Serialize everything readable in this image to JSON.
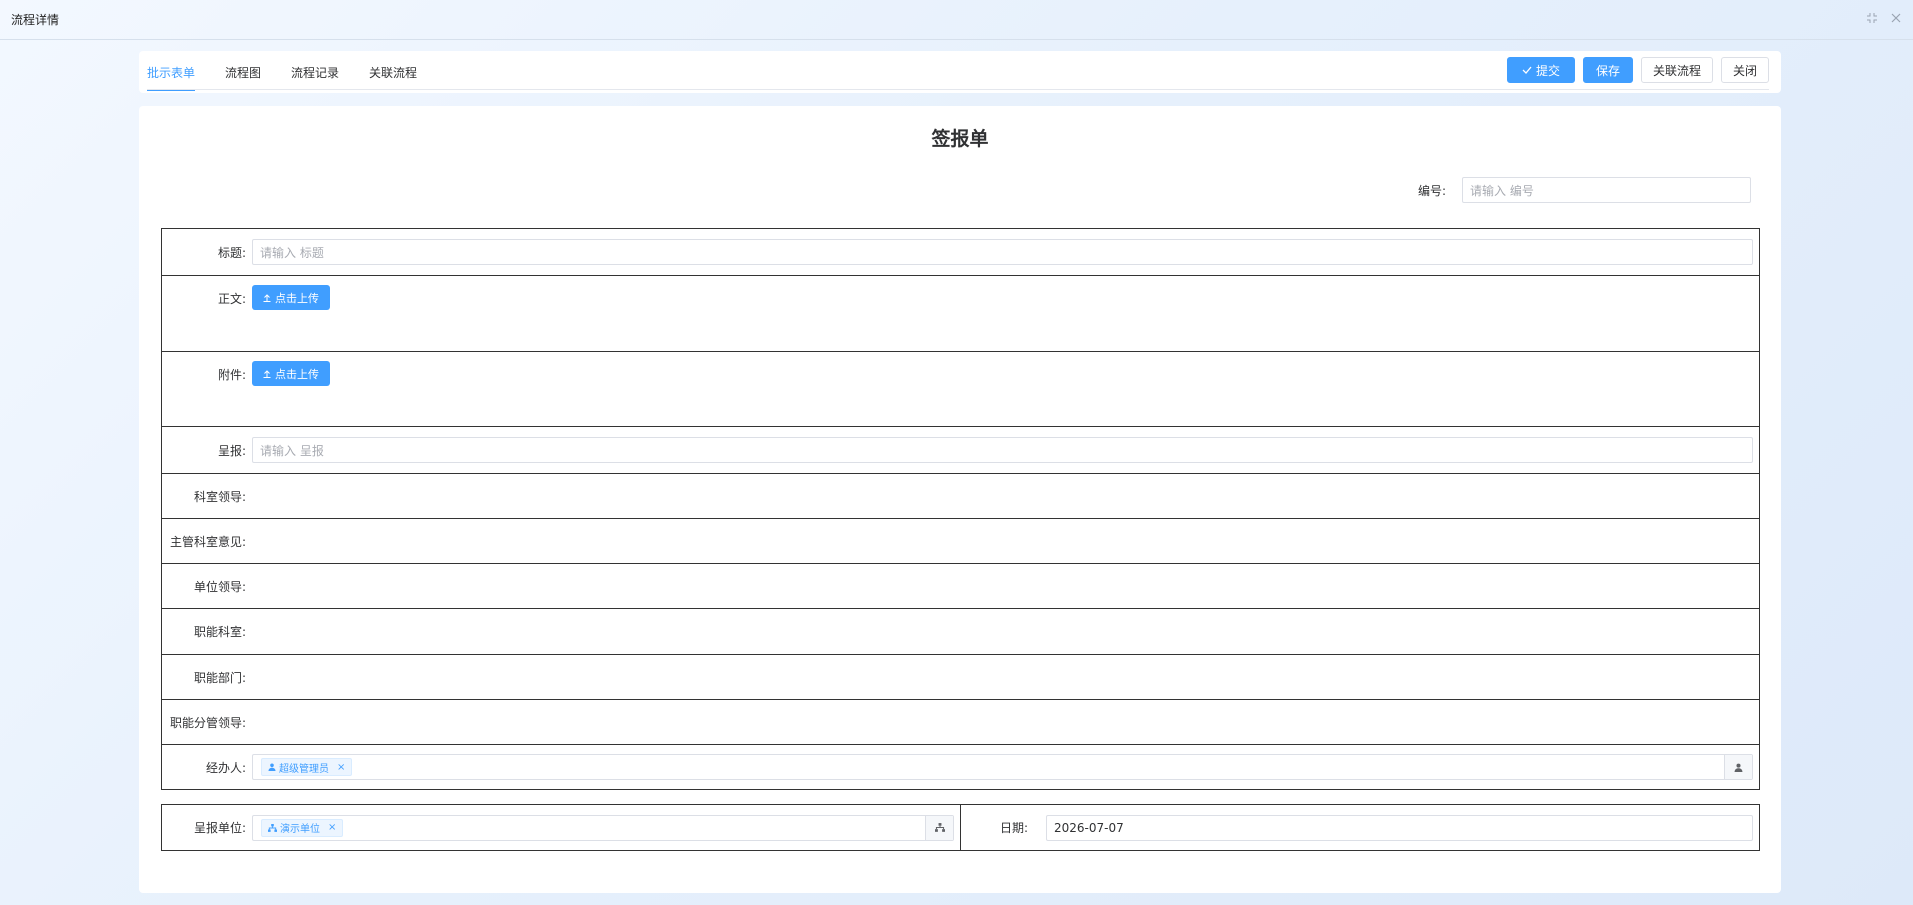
{
  "window": {
    "title": "流程详情"
  },
  "tabs": [
    {
      "label": "批示表单",
      "active": true
    },
    {
      "label": "流程图",
      "active": false
    },
    {
      "label": "流程记录",
      "active": false
    },
    {
      "label": "关联流程",
      "active": false
    }
  ],
  "actions": {
    "submit": "提交",
    "save": "保存",
    "related": "关联流程",
    "close": "关闭"
  },
  "form": {
    "title": "签报单",
    "number": {
      "label": "编号:",
      "placeholder": "请输入 编号"
    },
    "subject": {
      "label": "标题:",
      "placeholder": "请输入 标题"
    },
    "body": {
      "label": "正文:",
      "button": "点击上传"
    },
    "attachment": {
      "label": "附件:",
      "button": "点击上传"
    },
    "report": {
      "label": "呈报:",
      "placeholder": "请输入 呈报"
    },
    "section_leader": {
      "label": "科室领导:"
    },
    "dept_opinion": {
      "label": "主管科室意见:"
    },
    "unit_leader": {
      "label": "单位领导:"
    },
    "function_office": {
      "label": "职能科室:"
    },
    "function_dept": {
      "label": "职能部门:"
    },
    "function_leader": {
      "label": "职能分管领导:"
    },
    "handler": {
      "label": "经办人:",
      "tag": "超级管理员"
    },
    "report_unit": {
      "label": "呈报单位:",
      "tag": "演示单位"
    },
    "date": {
      "label": "日期:",
      "value": "2026-07-07"
    }
  },
  "colors": {
    "primary": "#409eff",
    "border": "#333333"
  }
}
